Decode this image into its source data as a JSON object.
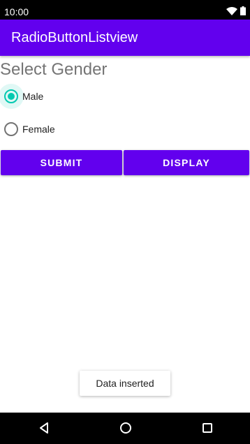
{
  "status_bar": {
    "time": "10:00",
    "icons": [
      "wifi-icon",
      "battery-icon"
    ]
  },
  "app_bar": {
    "title": "RadioButtonListview",
    "color": "#6200ee"
  },
  "form": {
    "heading": "Select Gender",
    "options": [
      {
        "label": "Male",
        "checked": true
      },
      {
        "label": "Female",
        "checked": false
      }
    ],
    "accent_color": "#03c9b0"
  },
  "buttons": {
    "submit_label": "SUBMIT",
    "display_label": "DISPLAY"
  },
  "toast": {
    "message": "Data inserted"
  },
  "nav_bar": {
    "icons": [
      "back-icon",
      "home-icon",
      "recent-apps-icon"
    ]
  }
}
